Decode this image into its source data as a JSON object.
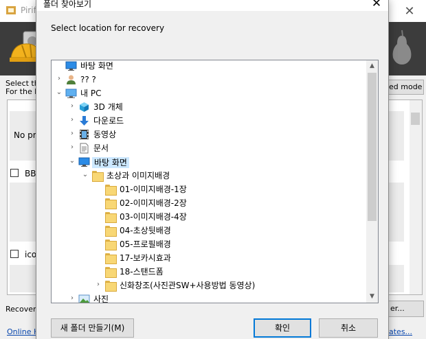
{
  "background_app": {
    "title": "Pirifo",
    "panel_text_1": "Select the",
    "panel_text_2": "For the be",
    "mode_button": "ed mode",
    "no_preview": "No pre",
    "checkbox_1_label": "BBI",
    "checkbox_2_label": "ico",
    "recovery_label": "Recovery",
    "er_button": "er...",
    "online_help": "Online He",
    "updates_link": "ates..."
  },
  "dialog": {
    "title": "폴더 찾아보기",
    "description": "Select location for recovery",
    "new_folder_button": "새 폴더 만들기(M)",
    "ok_button": "확인",
    "cancel_button": "취소"
  },
  "tree": {
    "items": [
      {
        "label": "바탕 화면",
        "icon": "desktop-icon",
        "twisty": ""
      },
      {
        "label": "?? ?",
        "icon": "user-icon",
        "twisty": "›"
      },
      {
        "label": "내 PC",
        "icon": "computer-icon",
        "twisty": "⌄"
      },
      {
        "label": "3D 개체",
        "icon": "3d-objects-icon",
        "twisty": "›"
      },
      {
        "label": "다운로드",
        "icon": "download-icon",
        "twisty": "›"
      },
      {
        "label": "동영상",
        "icon": "video-icon",
        "twisty": "›"
      },
      {
        "label": "문서",
        "icon": "document-icon",
        "twisty": "›"
      },
      {
        "label": "바탕 화면",
        "icon": "desktop-icon",
        "twisty": "⌄",
        "selected": true
      },
      {
        "label": "초상과 이미지배경",
        "icon": "folder-icon",
        "twisty": "⌄"
      },
      {
        "label": "01-이미지배경-1장",
        "icon": "folder-icon",
        "twisty": ""
      },
      {
        "label": "02-이미지배경-2장",
        "icon": "folder-icon",
        "twisty": ""
      },
      {
        "label": "03-이미지배경-4장",
        "icon": "folder-icon",
        "twisty": ""
      },
      {
        "label": "04-초상뒷배경",
        "icon": "folder-icon",
        "twisty": ""
      },
      {
        "label": "05-프로필배경",
        "icon": "folder-icon",
        "twisty": ""
      },
      {
        "label": "17-보카시효과",
        "icon": "folder-icon",
        "twisty": ""
      },
      {
        "label": "18-스탠드폼",
        "icon": "folder-icon",
        "twisty": ""
      },
      {
        "label": "신화창조(사진관SW+사용방법 동영상)",
        "icon": "folder-icon",
        "twisty": "›"
      },
      {
        "label": "사진",
        "icon": "pictures-icon",
        "twisty": "›"
      }
    ]
  }
}
